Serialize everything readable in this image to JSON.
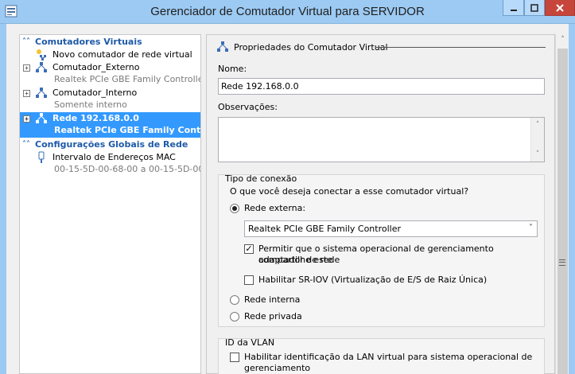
{
  "window": {
    "title": "Gerenciador de Comutador Virtual para SERVIDOR"
  },
  "sidebar": {
    "sections": [
      {
        "title": "Comutadores Virtuais"
      },
      {
        "title": "Configurações Globais de Rede"
      }
    ],
    "items": [
      {
        "label": "Novo comutador de rede virtual",
        "icon": "new-switch-icon"
      },
      {
        "label": "Comutador_Externo",
        "sub": "Realtek PCIe GBE Family Controller",
        "icon": "network-switch-icon"
      },
      {
        "label": "Comutador_Interno",
        "sub": "Somente interno",
        "icon": "network-switch-icon"
      },
      {
        "label": "Rede 192.168.0.0",
        "sub": "Realtek PCIe GBE Family Cont...",
        "icon": "network-switch-icon",
        "selected": true
      }
    ],
    "global_items": [
      {
        "label": "Intervalo de Endereços MAC",
        "sub": "00-15-5D-00-68-00 a 00-15-5D-00...",
        "icon": "mac-range-icon"
      }
    ]
  },
  "properties": {
    "header": "Propriedades do Comutador Virtual",
    "name_label": "Nome:",
    "name_value": "Rede 192.168.0.0",
    "notes_label": "Observações:",
    "notes_value": "",
    "connection_type": {
      "title": "Tipo de conexão",
      "question": "O que você deseja conectar a esse comutador virtual?",
      "external_label": "Rede externa:",
      "adapter_selected": "Realtek PCIe GBE Family Controller",
      "allow_mgmt_line1": "Permitir que o sistema operacional de gerenciamento compartilhe este",
      "allow_mgmt_line2": "adaptador de rede",
      "allow_mgmt_checked": true,
      "sriov_label": "Habilitar SR-IOV (Virtualização de E/S de Raiz Única)",
      "sriov_checked": false,
      "internal_label": "Rede interna",
      "private_label": "Rede privada",
      "selected_option": "external"
    },
    "vlan": {
      "title": "ID da VLAN",
      "enable_line1": "Habilitar identificação da LAN virtual para sistema operacional de",
      "enable_line2": "gerenciamento",
      "enable_checked": false
    }
  },
  "colors": {
    "titlebar": "#9ccaf3",
    "selection": "#3399ff",
    "section_header": "#1e5aa8",
    "close_button": "#c7463c"
  }
}
